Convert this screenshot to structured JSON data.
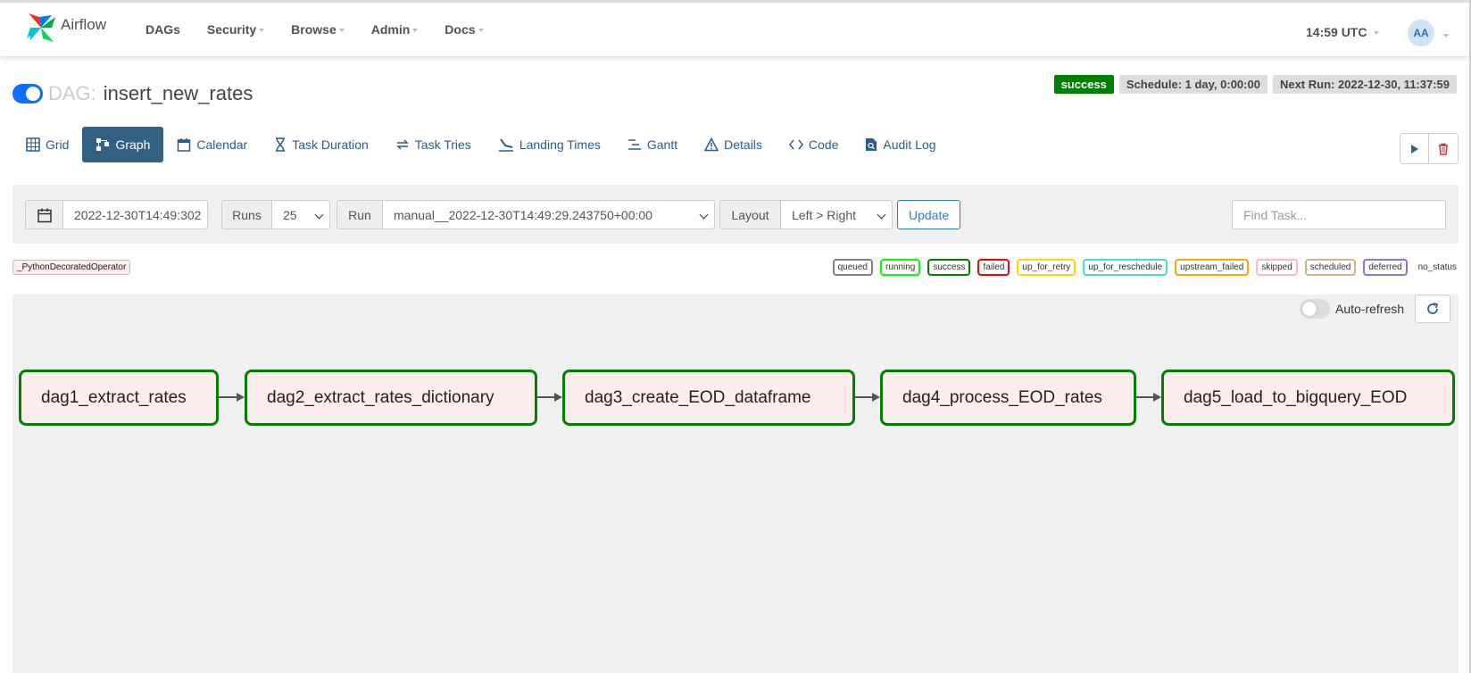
{
  "header": {
    "brand": "Airflow",
    "nav": [
      "DAGs",
      "Security",
      "Browse",
      "Admin",
      "Docs"
    ],
    "clock": "14:59 UTC",
    "avatar": "AA"
  },
  "dag": {
    "prefix": "DAG:",
    "name": "insert_new_rates",
    "paused": false,
    "badges": {
      "status": "success",
      "schedule": "Schedule: 1 day, 0:00:00",
      "next_run": "Next Run: 2022-12-30, 11:37:59"
    }
  },
  "tabs": [
    {
      "label": "Grid",
      "icon": "grid-icon"
    },
    {
      "label": "Graph",
      "icon": "graph-icon",
      "active": true
    },
    {
      "label": "Calendar",
      "icon": "calendar-icon"
    },
    {
      "label": "Task Duration",
      "icon": "hourglass-icon"
    },
    {
      "label": "Task Tries",
      "icon": "retry-icon"
    },
    {
      "label": "Landing Times",
      "icon": "landing-icon"
    },
    {
      "label": "Gantt",
      "icon": "gantt-icon"
    },
    {
      "label": "Details",
      "icon": "warning-triangle-icon"
    },
    {
      "label": "Code",
      "icon": "code-icon"
    },
    {
      "label": "Audit Log",
      "icon": "document-search-icon"
    }
  ],
  "toolbar": {
    "date_value": "2022-12-30T14:49:302",
    "runs_label": "Runs",
    "runs_value": "25",
    "run_label": "Run",
    "run_value": "manual__2022-12-30T14:49:29.243750+00:00",
    "layout_label": "Layout",
    "layout_value": "Left > Right",
    "update_label": "Update",
    "find_placeholder": "Find Task..."
  },
  "operator": "_PythonDecoratedOperator",
  "legend": [
    {
      "label": "queued",
      "color": "#808080"
    },
    {
      "label": "running",
      "color": "#00ff00"
    },
    {
      "label": "success",
      "color": "#008000"
    },
    {
      "label": "failed",
      "color": "#ff0000"
    },
    {
      "label": "up_for_retry",
      "color": "#ffd700"
    },
    {
      "label": "up_for_reschedule",
      "color": "#40e0d0"
    },
    {
      "label": "upstream_failed",
      "color": "#ffa500"
    },
    {
      "label": "skipped",
      "color": "#ffb6c1"
    },
    {
      "label": "scheduled",
      "color": "#d2b48c"
    },
    {
      "label": "deferred",
      "color": "#9370db"
    }
  ],
  "legend_no_status": "no_status",
  "graph": {
    "auto_refresh_label": "Auto-refresh",
    "tasks": [
      "dag1_extract_rates",
      "dag2_extract_rates_dictionary",
      "dag3_create_EOD_dataframe",
      "dag4_process_EOD_rates",
      "dag5_load_to_bigquery_EOD"
    ]
  }
}
